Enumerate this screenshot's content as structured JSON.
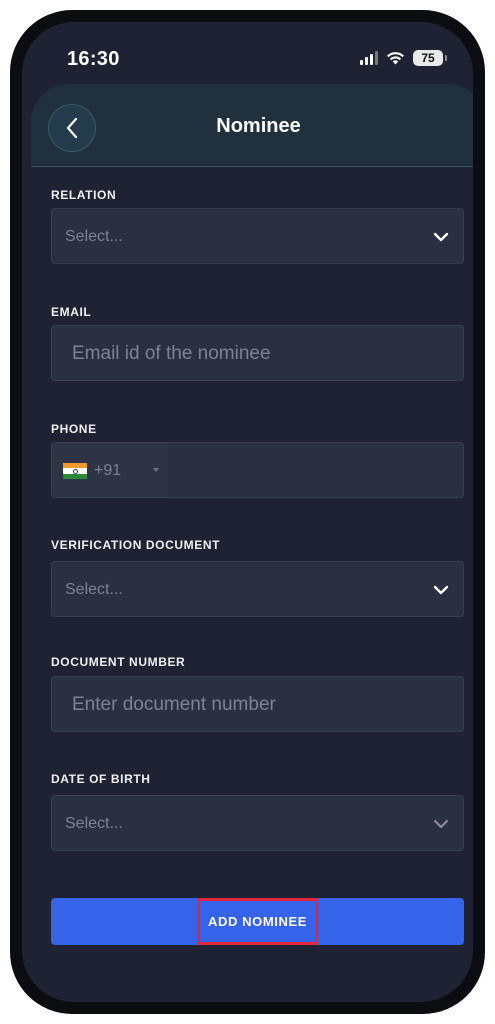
{
  "status_bar": {
    "time": "16:30",
    "battery": "75"
  },
  "header": {
    "title": "Nominee",
    "back_icon": "chevron-left-icon"
  },
  "form": {
    "relation": {
      "label": "RELATION",
      "value": "Select..."
    },
    "email": {
      "label": "EMAIL",
      "placeholder": "Email id of the nominee"
    },
    "phone": {
      "label": "PHONE",
      "country_code": "+91",
      "flag": "india-flag-icon"
    },
    "verification_document": {
      "label": "VERIFICATION DOCUMENT",
      "value": "Select..."
    },
    "document_number": {
      "label": "DOCUMENT NUMBER",
      "placeholder": "Enter document number"
    },
    "date_of_birth": {
      "label": "DATE OF BIRTH",
      "value": "Select..."
    }
  },
  "submit": {
    "label": "ADD NOMINEE"
  },
  "colors": {
    "background": "#1e2233",
    "field": "#2b2f42",
    "accent": "#3564ea",
    "highlight": "#e0273c"
  }
}
